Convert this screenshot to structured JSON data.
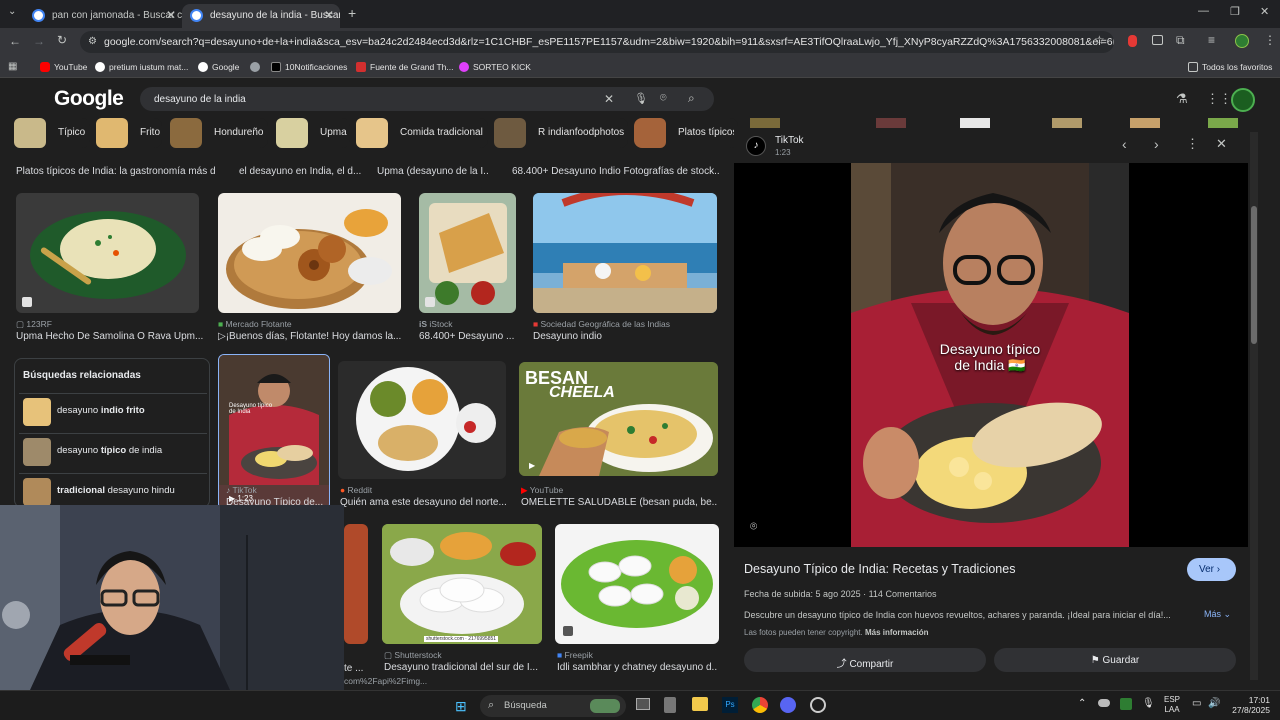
{
  "tabs": [
    {
      "title": "pan con jamonada - Buscar con"
    },
    {
      "title": "desayuno de la india - Buscar c"
    }
  ],
  "address": {
    "url": "google.com/search?q=desayuno+de+la+india&sca_esv=ba24c2d2484ecd3d&rlz=1C1CHBF_esPE1157PE1157&udm=2&biw=1920&bih=911&sxsrf=AE3TifOQlraaLwjo_Yfj_XNyP8cyaRZZdQ%3A1756332008081&ei=6H-vaLPhBNSR5OUPxZ..."
  },
  "bookmarks": [
    "YouTube",
    "pretium iustum mat...",
    "Google",
    "",
    "10Notificaciones",
    "Fuente de Grand Th...",
    "SORTEO KICK"
  ],
  "bookmarks_right": "Todos los favoritos",
  "google": {
    "logo": "Google",
    "query": "desayuno de la india",
    "chips": [
      "Típico",
      "Frito",
      "Hondureño",
      "Upma",
      "Comida tradicional",
      "R indianfoodphotos",
      "Platos típicos"
    ],
    "top_captions": [
      "Platos típicos de India: la gastronomía más d...",
      "el desayuno en India, el d...",
      "Upma (desayuno de la I...",
      "68.400+ Desayuno Indio Fotografías de stock..."
    ],
    "row1": [
      {
        "source": "123RF",
        "title": "Upma Hecho De Samolina O Rava Upm..."
      },
      {
        "source": "Mercado Flotante",
        "title": "▷¡Buenos días, Flotante! Hoy damos la..."
      },
      {
        "source": "iStock",
        "title": "68.400+ Desayuno ..."
      },
      {
        "source": "Sociedad Geográfica de las Indias",
        "title": "Desayuno indio"
      }
    ],
    "related": {
      "heading": "Búsquedas relacionadas",
      "items": [
        {
          "pre": "desayuno ",
          "bold": "indio frito",
          "post": ""
        },
        {
          "pre": "desayuno ",
          "bold": "típico",
          "post": " de india"
        },
        {
          "pre": "",
          "bold": "tradicional",
          "post": " desayuno hindu"
        }
      ]
    },
    "row2": [
      {
        "source": "TikTok",
        "title": "Desayuno Típico de...",
        "duration": "1:23"
      },
      {
        "source": "Reddit",
        "title": "Quién ama este desayuno del norte..."
      },
      {
        "source": "YouTube",
        "title": "OMELETTE SALUDABLE (besan puda, be..."
      }
    ],
    "besan_text": "BESAN",
    "cheela_text": "CHEELA",
    "row3": [
      {
        "source": "Shutterstock",
        "title": "Desayuno tradicional del sur de I..."
      },
      {
        "source": "Freepik",
        "title": "Idli sambhar y chatney desayuno d..."
      }
    ],
    "row3_left_fragment": "te ...",
    "url_fragment": "com%2Fapi%2Fimg...",
    "watermark": "shutterstock.com · 2176995851"
  },
  "panel": {
    "source": "TikTok",
    "duration": "1:23",
    "overlay_line1": "Desayuno típico",
    "overlay_line2": "de India 🇮🇳",
    "title": "Desayuno Típico de India: Recetas y Tradiciones",
    "view_label": "Ver",
    "meta": "Fecha de subida: 5 ago 2025",
    "comments": "114 Comentarios",
    "description": "Descubre un desayuno típico de India con huevos revueltos, achares y paranda. ¡Ideal para iniciar el día!...",
    "more_label": "Más",
    "copyright": "Las fotos pueden tener copyright.",
    "more_info": "Más información",
    "share_label": "Compartir",
    "save_label": "Guardar"
  },
  "taskbar": {
    "search_placeholder": "Búsqueda",
    "lang1": "ESP",
    "lang2": "LAA",
    "time": "17:01",
    "date": "27/8/2025"
  }
}
